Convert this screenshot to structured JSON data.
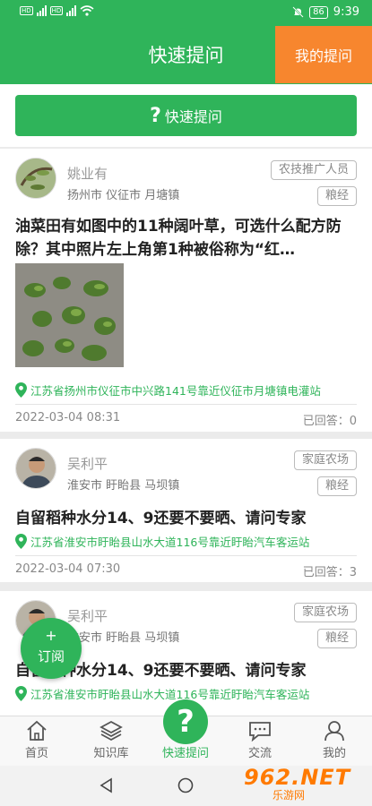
{
  "status_bar": {
    "time": "9:39",
    "battery": "86",
    "hd1": "HD",
    "hd2": "HD"
  },
  "header": {
    "title": "快速提问",
    "my_questions": "我的提问"
  },
  "ask_button": {
    "icon": "?",
    "label": "快速提问"
  },
  "posts": [
    {
      "name": "姚业有",
      "location": "扬州市 仪征市 月塘镇",
      "role": "农技推广人员",
      "category": "粮经",
      "title": "油菜田有如图中的11种阔叶草，可选什么配方防除？其中照片左上角第1种被俗称为“红…",
      "address": "江苏省扬州市仪征市中兴路141号靠近仪征市月塘镇电灌站",
      "date": "2022-03-04 08:31",
      "answers": "已回答：0"
    },
    {
      "name": "吴利平",
      "location": "淮安市 盱眙县 马坝镇",
      "role": "家庭农场",
      "category": "粮经",
      "title": "自留稻种水分14、9还要不要晒、请问专家",
      "address": "江苏省淮安市盱眙县山水大道116号靠近盱眙汽车客运站",
      "date": "2022-03-04 07:30",
      "answers": "已回答：3"
    },
    {
      "name": "吴利平",
      "location": "淮安市 盱眙县 马坝镇",
      "role": "家庭农场",
      "category": "粮经",
      "title": "自留稻种水分14、9还要不要晒、请问专家",
      "address": "江苏省淮安市盱眙县山水大道116号靠近盱眙汽车客运站"
    }
  ],
  "subscribe": {
    "plus": "+",
    "label": "订阅"
  },
  "nav": {
    "items": [
      {
        "label": "首页",
        "icon": "home-icon"
      },
      {
        "label": "知识库",
        "icon": "layers-icon"
      },
      {
        "label": "快速提问",
        "icon": "question-icon"
      },
      {
        "label": "交流",
        "icon": "chat-icon"
      },
      {
        "label": "我的",
        "icon": "user-icon"
      }
    ],
    "center_icon": "?"
  },
  "watermark": {
    "big": "962.NET",
    "small": "乐游网"
  },
  "colors": {
    "primary": "#2fb45a",
    "accent": "#f7862e"
  }
}
